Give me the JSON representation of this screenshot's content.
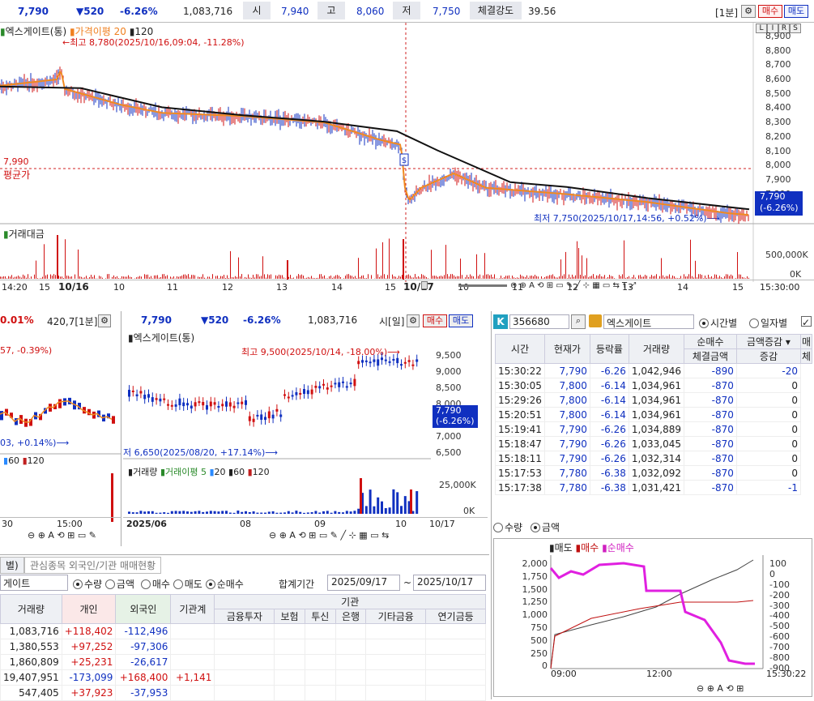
{
  "top": {
    "price": "7,790",
    "change": "▼520",
    "rate": "-6.26%",
    "volume": "1,083,716",
    "open_label": "시",
    "open": "7,940",
    "high_label": "고",
    "high": "8,060",
    "low_label": "저",
    "low": "7,750",
    "strength_label": "체결강도",
    "strength": "39.56",
    "period": "[1분]",
    "buy": "매수",
    "sell": "매도"
  },
  "main_chart": {
    "legend_name": "엑스게이트(통)",
    "legend_ma": "가격이평 20",
    "legend_120": "120",
    "max_note": "←최고 8,780(2025/10/16,09:04, -11.28%)",
    "min_note": "최저 7,750(2025/10/17,14:56, +0.52%)⟶",
    "avg_value": "7,990",
    "avg_label": "평균가",
    "price_tag": "7,790",
    "price_tag_rate": "(-6.26%)",
    "mode_btns": [
      "L",
      "I",
      "R",
      "S"
    ],
    "y_labels": [
      "8,900",
      "8,800",
      "8,700",
      "8,600",
      "8,500",
      "8,400",
      "8,300",
      "8,200",
      "8,100",
      "8,000",
      "7,900",
      "7,800"
    ],
    "vol_legend": "거래대금",
    "vol_y": [
      "500,000K",
      "0K"
    ],
    "x_labels": [
      "14:20",
      "15",
      "10/16",
      "10",
      "11",
      "12",
      "13",
      "14",
      "15",
      "10/17",
      "10",
      "11",
      "12",
      "13",
      "14",
      "15",
      "15:30:00"
    ]
  },
  "chart_data": {
    "type": "line",
    "title": "엑스게이트(통)",
    "series": [
      {
        "name": "가격이평 20"
      },
      {
        "name": "120"
      }
    ],
    "ylim": [
      7750,
      8950
    ],
    "x": [
      "10/16",
      "10",
      "11",
      "12",
      "13",
      "14",
      "15",
      "10/17",
      "10",
      "11",
      "12",
      "13",
      "14",
      "15"
    ],
    "high": 8780,
    "low": 7750,
    "avg": 7990
  },
  "left_panel": {
    "rate": "0.01%",
    "info": "420,7[1분]",
    "note1": "57, -0.39%)",
    "note2": "03, +0.14%)⟶",
    "leg1": "60",
    "leg2": "120",
    "x": [
      "30",
      "15:00"
    ]
  },
  "mid_panel": {
    "price": "7,790",
    "change": "▼520",
    "rate": "-6.26%",
    "volume": "1,083,716",
    "period": "시[일]",
    "buy": "매수",
    "sell": "매도",
    "name": "엑스게이트(통)",
    "max_note": "최고 9,500(2025/10/14, -18.00%)⟶",
    "min_note": "저 6,650(2025/08/20, +17.14%)⟶",
    "y": [
      "9,500",
      "9,000",
      "8,500",
      "8,000",
      "7,500",
      "7,000",
      "6,500"
    ],
    "tag": "7,790",
    "tag_rate": "(-6.26%)",
    "vol_legend": "거래량",
    "vol_ma": "거래이평 5",
    "ma20": "20",
    "ma60": "60",
    "ma120": "120",
    "vol_y": [
      "25,000K",
      "0K"
    ],
    "x": [
      "2025/06",
      "08",
      "09",
      "10",
      "10/17"
    ]
  },
  "right_panel": {
    "code": "356680",
    "name": "엑스게이트",
    "opt_time": "시간별",
    "opt_day": "일자별",
    "cols": [
      "시간",
      "현재가",
      "등락률",
      "거래량"
    ],
    "net_label": "순매수",
    "amount_sel": "금액증감",
    "col_sell": "매",
    "sub1": "체결금액",
    "sub2": "증감",
    "sub3": "체",
    "rows": [
      [
        "15:30:22",
        "7,790",
        "-6.26",
        "1,042,946",
        "-890",
        "-20"
      ],
      [
        "15:30:05",
        "7,800",
        "-6.14",
        "1,034,961",
        "-870",
        "0"
      ],
      [
        "15:29:26",
        "7,800",
        "-6.14",
        "1,034,961",
        "-870",
        "0"
      ],
      [
        "15:20:51",
        "7,800",
        "-6.14",
        "1,034,961",
        "-870",
        "0"
      ],
      [
        "15:19:41",
        "7,790",
        "-6.26",
        "1,034,889",
        "-870",
        "0"
      ],
      [
        "15:18:47",
        "7,790",
        "-6.26",
        "1,033,045",
        "-870",
        "0"
      ],
      [
        "15:18:11",
        "7,790",
        "-6.26",
        "1,032,314",
        "-870",
        "0"
      ],
      [
        "15:17:53",
        "7,780",
        "-6.38",
        "1,032,092",
        "-870",
        "0"
      ],
      [
        "15:17:38",
        "7,780",
        "-6.38",
        "1,031,421",
        "-870",
        "-1"
      ]
    ],
    "opt_qty": "수량",
    "opt_amt": "금액",
    "legend_sell": "매도",
    "legend_buy": "매수",
    "legend_net": "순매수",
    "y_left": [
      "2,000",
      "1,750",
      "1,500",
      "1,250",
      "1,000",
      "750",
      "500",
      "250",
      "0"
    ],
    "y_right": [
      "100",
      "0",
      "-100",
      "-200",
      "-300",
      "-400",
      "-500",
      "-600",
      "-700",
      "-800",
      "-900"
    ],
    "x": [
      "09:00",
      "12:00",
      "15:30:22"
    ]
  },
  "bottom": {
    "tab1": "별)",
    "tab2": "관심종목 외국인/기관 매매현황",
    "name": "게이트",
    "opt_qty": "수량",
    "opt_amt": "금액",
    "opt_buy": "매수",
    "opt_sell": "매도",
    "opt_net": "순매수",
    "period_label": "합계기간",
    "from": "2025/09/17",
    "to": "2025/10/17",
    "inst": "기관",
    "cols": [
      "거래량",
      "개인",
      "외국인",
      "기관계"
    ],
    "sub_cols": [
      "금융투자",
      "보험",
      "투신",
      "은행",
      "기타금융",
      "연기금등"
    ],
    "rows": [
      [
        "1,083,716",
        "+118,402",
        "-112,496",
        ""
      ],
      [
        "1,380,553",
        "+97,252",
        "-97,306",
        ""
      ],
      [
        "1,860,809",
        "+25,231",
        "-26,617",
        ""
      ],
      [
        "19,407,951",
        "-173,099",
        "+168,400",
        "+1,141"
      ],
      [
        "547,405",
        "+37,923",
        "-37,953",
        ""
      ]
    ]
  }
}
